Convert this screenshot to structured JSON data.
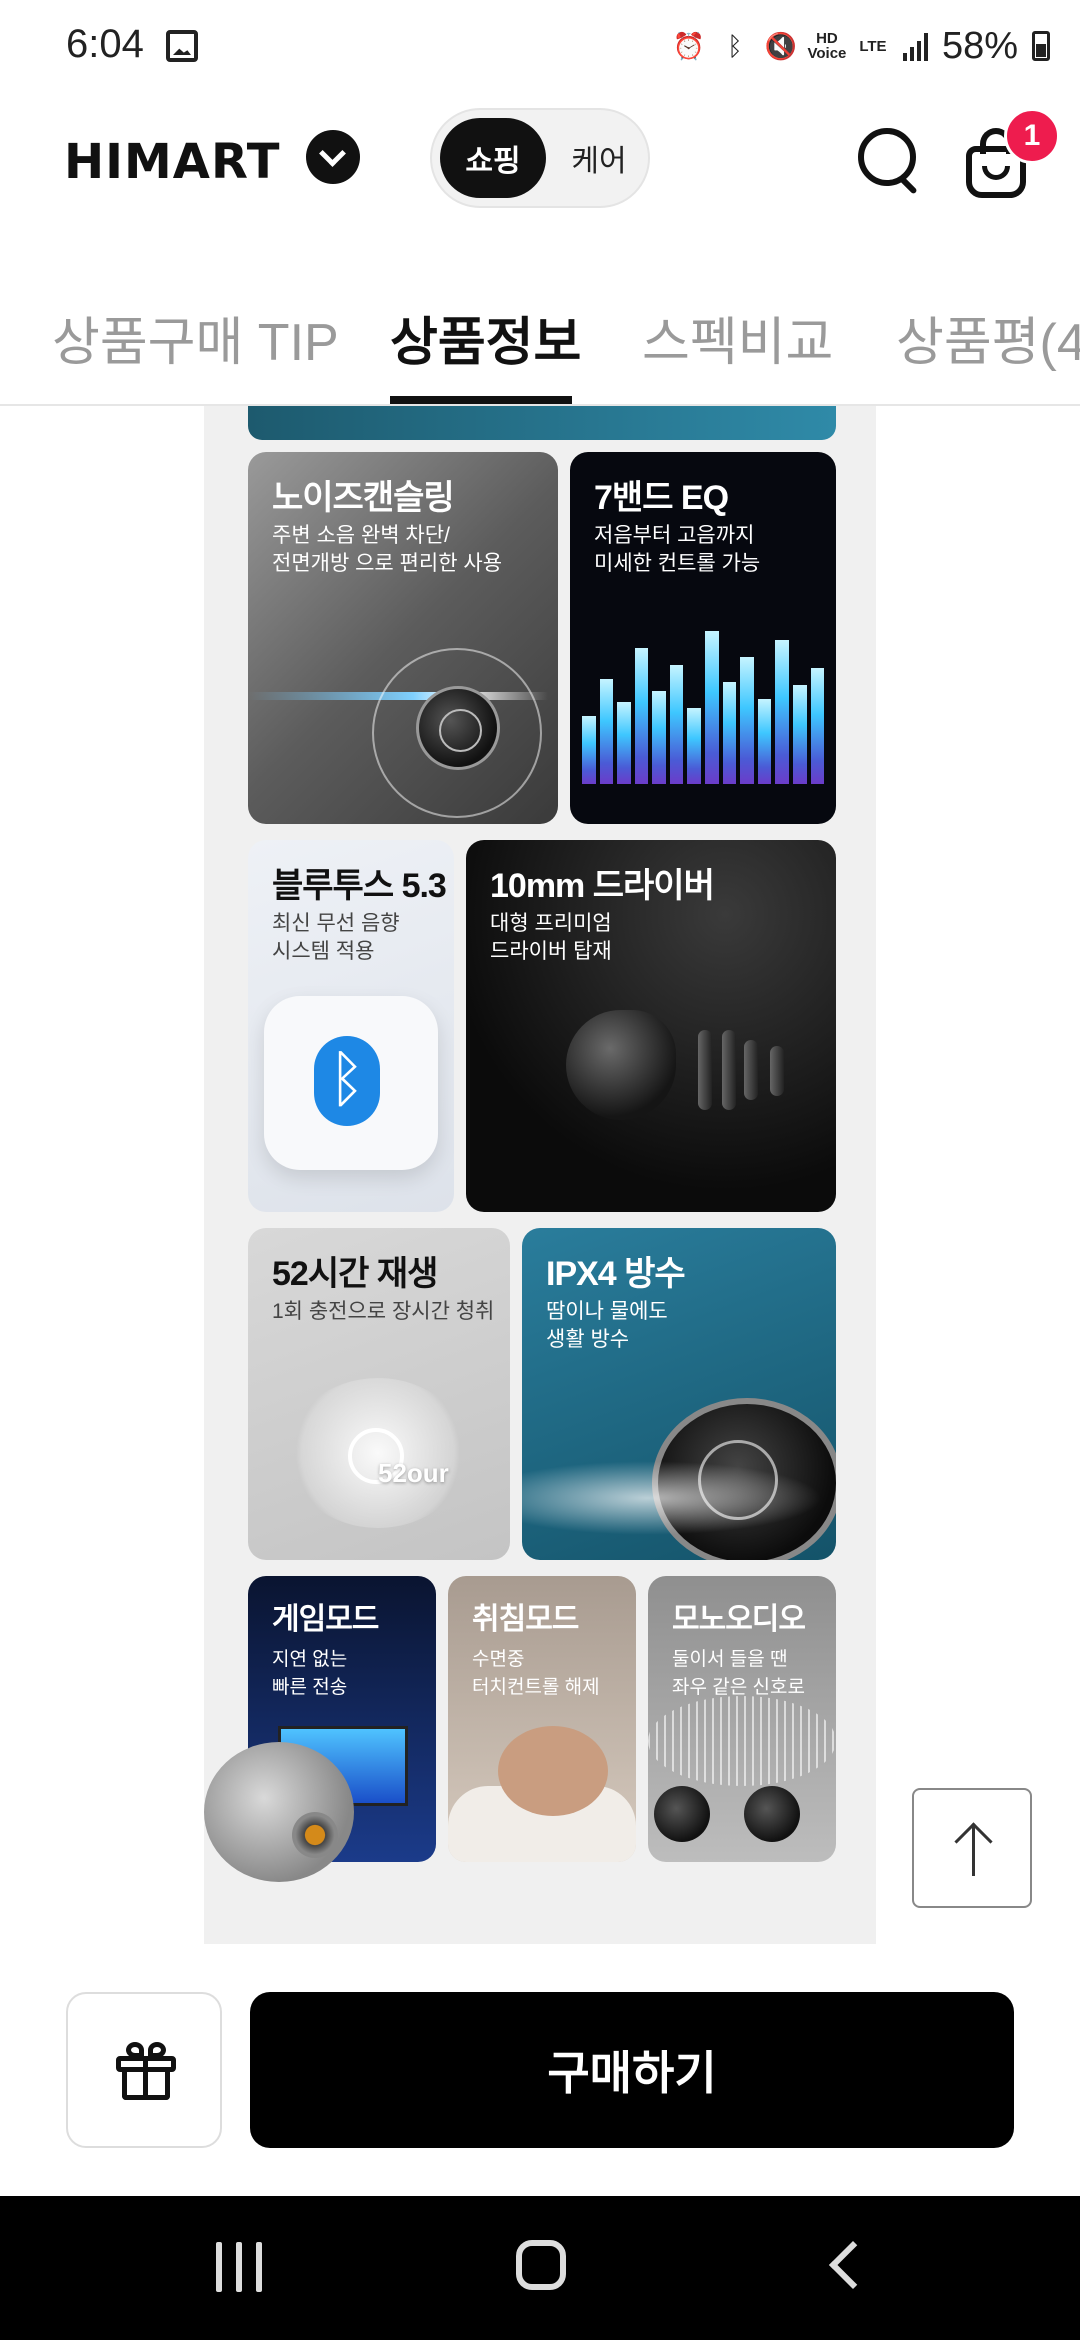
{
  "status_bar": {
    "time": "6:04",
    "battery": "58%",
    "hd_voice": "HD\nVoice",
    "lte": "LTE"
  },
  "header": {
    "logo": "HIMART",
    "segment": {
      "active": "쇼핑",
      "inactive": "케어"
    },
    "cart_badge": "1"
  },
  "tabs": [
    {
      "label": "상품구매 TIP"
    },
    {
      "label": "상품정보"
    },
    {
      "label": "스펙비교"
    },
    {
      "label": "상품평(4"
    }
  ],
  "features": [
    {
      "title": "노이즈캔슬링",
      "desc": "주변 소음 완벽 차단/\n전면개방 으로 편리한 사용"
    },
    {
      "title": "7밴드 EQ",
      "desc": "저음부터 고음까지\n미세한 컨트롤 가능"
    },
    {
      "title": "블루투스 5.3",
      "desc": "최신 무선 음향\n시스템 적용"
    },
    {
      "title": "10mm 드라이버",
      "desc": "대형 프리미엄\n드라이버 탑재"
    },
    {
      "title": "52시간 재생",
      "desc": "1회 충전으로 장시간 청취"
    },
    {
      "title": "IPX4 방수",
      "desc": "땀이나 물에도\n생활 방수"
    },
    {
      "title": "게임모드",
      "desc": "지연 없는\n빠른 전송"
    },
    {
      "title": "취침모드",
      "desc": "수면중\n터치컨트롤 해제"
    },
    {
      "title": "모노오디오",
      "desc": "둘이서 들을 땐\n좌우 같은 신호로"
    }
  ],
  "clock_label": "52our",
  "bottom": {
    "buy_label": "구매하기"
  },
  "colors": {
    "badge": "#ee1c4e",
    "buy_button": "#000000",
    "active_tab": "#111111",
    "inactive_tab": "#9a9a9a"
  }
}
